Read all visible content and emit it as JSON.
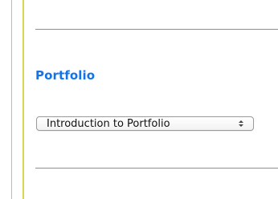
{
  "section": {
    "title": "Portfolio"
  },
  "select": {
    "value": "Introduction to Portfolio",
    "icon": "up-down-arrows-icon"
  },
  "colors": {
    "title": "#1473e6",
    "accent_bar": "#d4d94f",
    "divider": "#8f8f8f"
  }
}
